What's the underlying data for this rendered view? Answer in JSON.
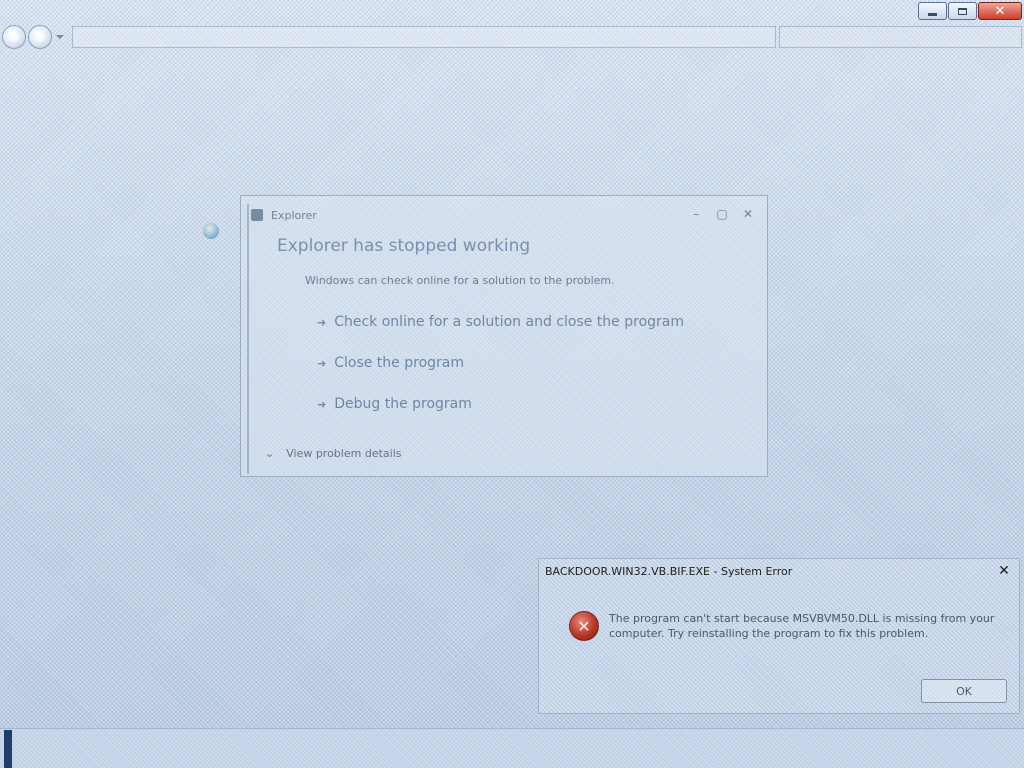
{
  "window": {
    "minimize_icon": "minimize-icon",
    "maximize_icon": "restore-icon",
    "close_icon": "close-icon",
    "close_color": "#c8402c"
  },
  "crash_dialog": {
    "title": "Explorer",
    "heading": "Explorer has stopped working",
    "subtext": "Windows can check online for a solution to the problem.",
    "options": [
      "Check online for a solution and close the program",
      "Close the program",
      "Debug the program"
    ],
    "details_label": "View problem details"
  },
  "error_dialog": {
    "title": "BACKDOOR.WIN32.VB.BIF.EXE - System Error",
    "message": "The program can't start because MSVBVM50.DLL is missing from your computer. Try reinstalling the program to fix this problem.",
    "ok_label": "OK",
    "icon": "error-icon",
    "icon_color": "#b5382a"
  }
}
